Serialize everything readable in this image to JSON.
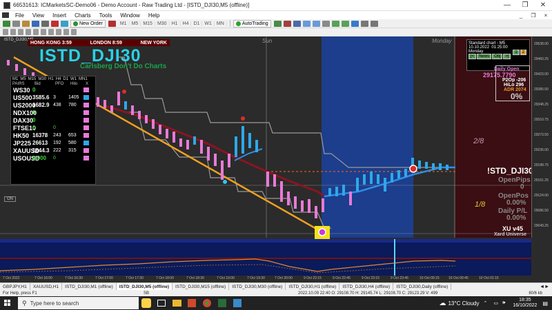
{
  "window": {
    "title": "66531613: ICMarketsSC-Demo06 - Demo Account - Raw Trading Ltd - [ISTD_DJI30,M5 (offline)]",
    "controls": [
      "—",
      "❐",
      "✕"
    ]
  },
  "menu": {
    "items": [
      "File",
      "View",
      "Insert",
      "Charts",
      "Tools",
      "Window",
      "Help"
    ],
    "mdi_controls": [
      "_",
      "❐",
      "×"
    ]
  },
  "toolbar": {
    "new_order": "New Order",
    "autotrading": "AutoTrading",
    "timeframes": [
      "M1",
      "M5",
      "M15",
      "M30",
      "H1",
      "H4",
      "D1",
      "W1",
      "MN"
    ]
  },
  "chart": {
    "symbol_big": "ISTD_DJI30",
    "subtitle": "Carlsberg Don't Do Charts",
    "corner_label": "ISTD_DJI30,M5",
    "sessions": [
      "HONG KONG 3:59",
      "LONDON 8:59",
      "NEW YORK"
    ],
    "day_labels": [
      "Sun",
      "Monday"
    ],
    "fib_labels": [
      "2/8",
      "1/8"
    ],
    "on_button": "ON"
  },
  "pairs_table": {
    "header": [
      "M1",
      "M5",
      "M15",
      "M30",
      "H1",
      "H4",
      "D1",
      "W1",
      "MN1"
    ],
    "subheader": [
      "PAIRS",
      "Bid",
      "PFO",
      "Hilo",
      "X"
    ],
    "rows": [
      {
        "sym": "WS30",
        "v1": "0",
        "v2": "",
        "v3": ""
      },
      {
        "sym": "US500",
        "v1": "3585.6",
        "v2": "3",
        "v3": "1405"
      },
      {
        "sym": "US2000",
        "v1": "1682.9",
        "v2": "438",
        "v3": "780"
      },
      {
        "sym": "NDX100",
        "v1": "0",
        "v2": "",
        "v3": ""
      },
      {
        "sym": "DAX30",
        "v1": "0",
        "v2": "",
        "v3": ""
      },
      {
        "sym": "FTSE10",
        "v1": "0",
        "v2": "0",
        "v3": ""
      },
      {
        "sym": "HK50",
        "v1": "16378",
        "v2": "243",
        "v3": "653"
      },
      {
        "sym": "JP225",
        "v1": "26613",
        "v2": "192",
        "v3": "580"
      },
      {
        "sym": "XAUUSD",
        "v1": "1644.3",
        "v2": "222",
        "v3": "315"
      },
      {
        "sym": "USOUSD",
        "v1": "0.000",
        "v2": "0",
        "v3": ""
      }
    ]
  },
  "std_chart": {
    "title": "Standard chart - M5",
    "date": "10.10.2022",
    "time": "01:25:00",
    "day": "Monday",
    "buttons": [
      "|<",
      "News",
      "Obj",
      ">|"
    ],
    "nums": [
      "1",
      "2",
      "3",
      "4"
    ]
  },
  "right_panel": {
    "daily_open_label": "Daily Open",
    "daily_open_value": "29175.7790",
    "p2op": "P2Op -206",
    "hilo": "HiLo 296",
    "adr": "ADR 2074",
    "pct": "0%",
    "symbol": "!STD_DJI30",
    "open_pips_label": "OpenPips",
    "open_pips_value": "0",
    "open_pos_label": "OpenPos",
    "open_pos_value": "0.00%",
    "daily_pl_label": "Daily P/L",
    "daily_pl_value": "0.00%",
    "version": "XU v45",
    "brand": "Xard Universe"
  },
  "price_axis": [
    "29538.00",
    "29460.25",
    "29423.00",
    "29385.50",
    "29348.25",
    "29310.75",
    "29273.50",
    "29236.00",
    "29198.75",
    "29161.25",
    "29124.00",
    "29086.50",
    "29049.25"
  ],
  "time_axis": [
    "7 Oct 2022",
    "7 Oct 16:00",
    "7 Oct 16:30",
    "7 Oct 17:00",
    "7 Oct 17:30",
    "7 Oct 18:00",
    "7 Oct 18:30",
    "7 Oct 19:00",
    "7 Oct 19:30",
    "7 Oct 20:00",
    "9 Oct 22:15",
    "9 Oct 22:45",
    "9 Oct 23:15",
    "9 Oct 23:45",
    "10 Oct 00:15",
    "10 Oct 00:45",
    "10 Oct 01:15"
  ],
  "tabs": [
    "GBPJPY,H1",
    "XAUUSD,H1",
    "ISTD_DJI30,M1 (offline)",
    "ISTD_DJI30,M5 (offline)",
    "ISTD_DJI30,M15 (offline)",
    "ISTD_DJI30,M30 (offline)",
    "ISTD_DJI30,H1 (offline)",
    "ISTD_DJI30,H4 (offline)",
    "ISTD_DJI30,Daily (offline)"
  ],
  "active_tab": "ISTD_DJI30,M5 (offline)",
  "status": {
    "help": "For Help, press F1",
    "profile": "SB",
    "bar_info": "2022.10.09 22:40   O: 29108.70   H: 29145.74   L: 29108.70   C: 29123.29   V: 499",
    "kb": "80/6 kb"
  },
  "taskbar": {
    "search_placeholder": "Type here to search",
    "weather": "13°C  Cloudy",
    "time": "18:35",
    "date": "16/10/2022"
  }
}
